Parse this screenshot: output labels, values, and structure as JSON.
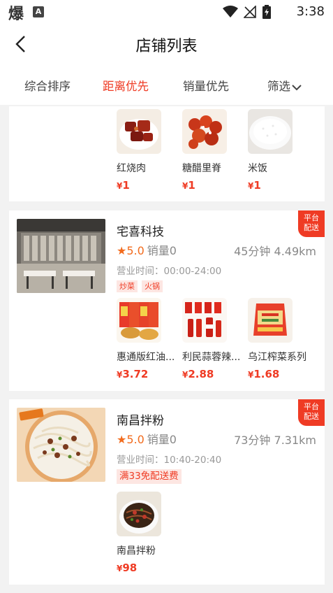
{
  "status_bar": {
    "app_glyph": "爆",
    "time": "3:38"
  },
  "header": {
    "title": "店铺列表"
  },
  "tabs": [
    {
      "label": "综合排序",
      "active": false
    },
    {
      "label": "距离优先",
      "active": true
    },
    {
      "label": "销量优先",
      "active": false
    },
    {
      "label": "筛选",
      "active": false
    }
  ],
  "currency": "¥",
  "partial_store": {
    "dishes": [
      {
        "name": "红烧肉",
        "price": "1"
      },
      {
        "name": "糖醋里脊",
        "price": "1"
      },
      {
        "name": "米饭",
        "price": "1"
      }
    ]
  },
  "stores": [
    {
      "name": "宅喜科技",
      "badge": "平台配送",
      "badge_line1": "平台",
      "badge_line2": "配送",
      "rating": "5.0",
      "sales": "销量0",
      "delivery": "45分钟 4.49km",
      "hours": "营业时间：00:00-24:00",
      "tags": [
        "炒菜",
        "火锅"
      ],
      "dishes": [
        {
          "name": "惠通版红油...",
          "price": "3.72"
        },
        {
          "name": "利民蒜蓉辣...",
          "price": "2.88"
        },
        {
          "name": "乌江榨菜系列",
          "price": "1.68"
        }
      ]
    },
    {
      "name": "南昌拌粉",
      "badge": "平台配送",
      "badge_line1": "平台",
      "badge_line2": "配送",
      "rating": "5.0",
      "sales": "销量0",
      "delivery": "73分钟 7.31km",
      "hours": "营业时间：10:40-20:40",
      "promo": "满33免配送费",
      "dishes": [
        {
          "name": "南昌拌粉",
          "price": "98"
        }
      ]
    }
  ],
  "colors": {
    "accent": "#ef3b24",
    "rating": "#f26b1d",
    "background": "#f2f2f2"
  },
  "icons": [
    "back-arrow-icon",
    "chevron-down-icon",
    "star-icon",
    "wifi-icon",
    "signal-icon",
    "battery-icon"
  ]
}
